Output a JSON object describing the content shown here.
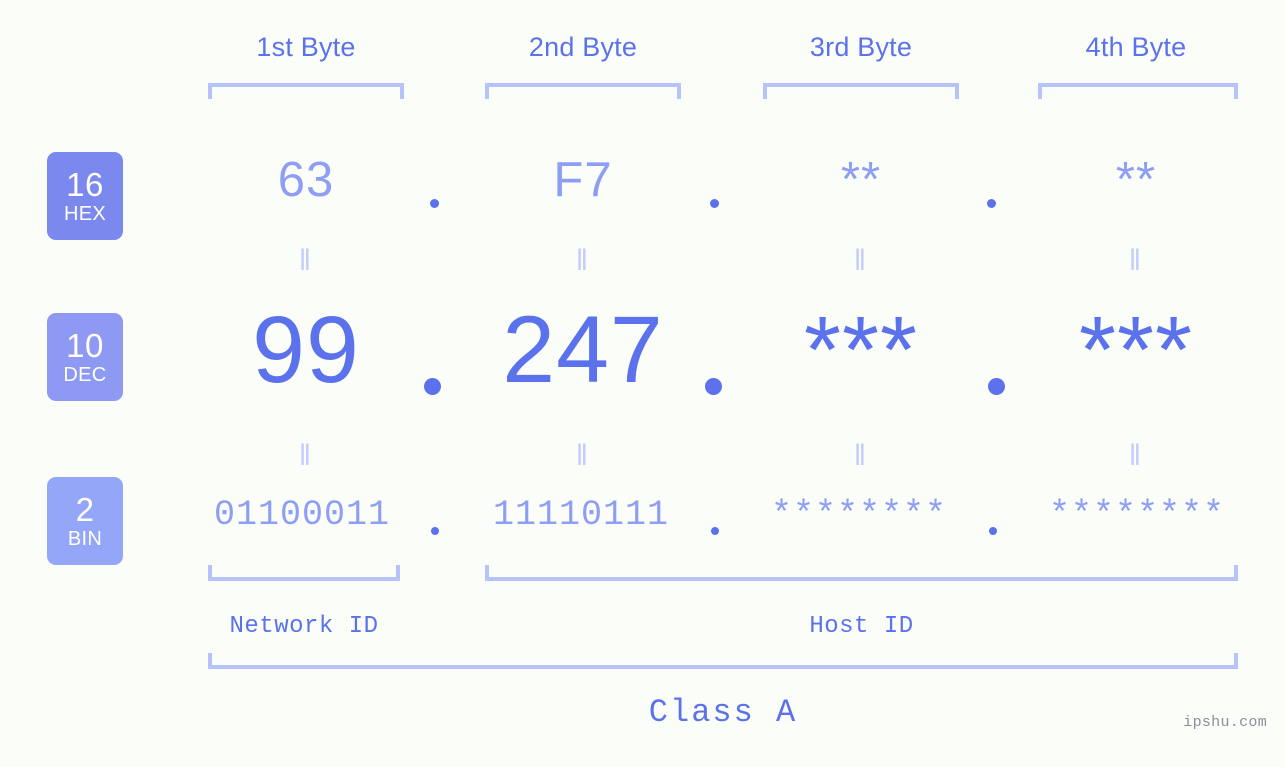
{
  "page": {
    "background_color": "#fbfdf8",
    "accent_color": "#5b72ec",
    "accent_light_color": "#8e9ef4",
    "bracket_color": "#b9c3fb",
    "watermark": "ipshu.com"
  },
  "byte_headers": [
    {
      "label": "1st Byte"
    },
    {
      "label": "2nd Byte"
    },
    {
      "label": "3rd Byte"
    },
    {
      "label": "4th Byte"
    }
  ],
  "bases": [
    {
      "number": "16",
      "name": "HEX",
      "color": "#7b89ee"
    },
    {
      "number": "10",
      "name": "DEC",
      "color": "#8d99f2"
    },
    {
      "number": "2",
      "name": "BIN",
      "color": "#93a6f7"
    }
  ],
  "rows": {
    "hex": {
      "values": [
        "63",
        "F7",
        "**",
        "**"
      ],
      "separator": "."
    },
    "dec": {
      "values": [
        "99",
        "247",
        "***",
        "***"
      ],
      "separator": "."
    },
    "bin": {
      "values": [
        "01100011",
        "11110111",
        "********",
        "********"
      ],
      "separator": "."
    }
  },
  "equality_marks": {
    "hex_to_dec": [
      "‖",
      "‖",
      "‖",
      "‖"
    ],
    "dec_to_bin": [
      "‖",
      "‖",
      "‖",
      "‖"
    ]
  },
  "id_spans": {
    "network": "Network ID",
    "host": "Host ID"
  },
  "class_label": "Class A"
}
